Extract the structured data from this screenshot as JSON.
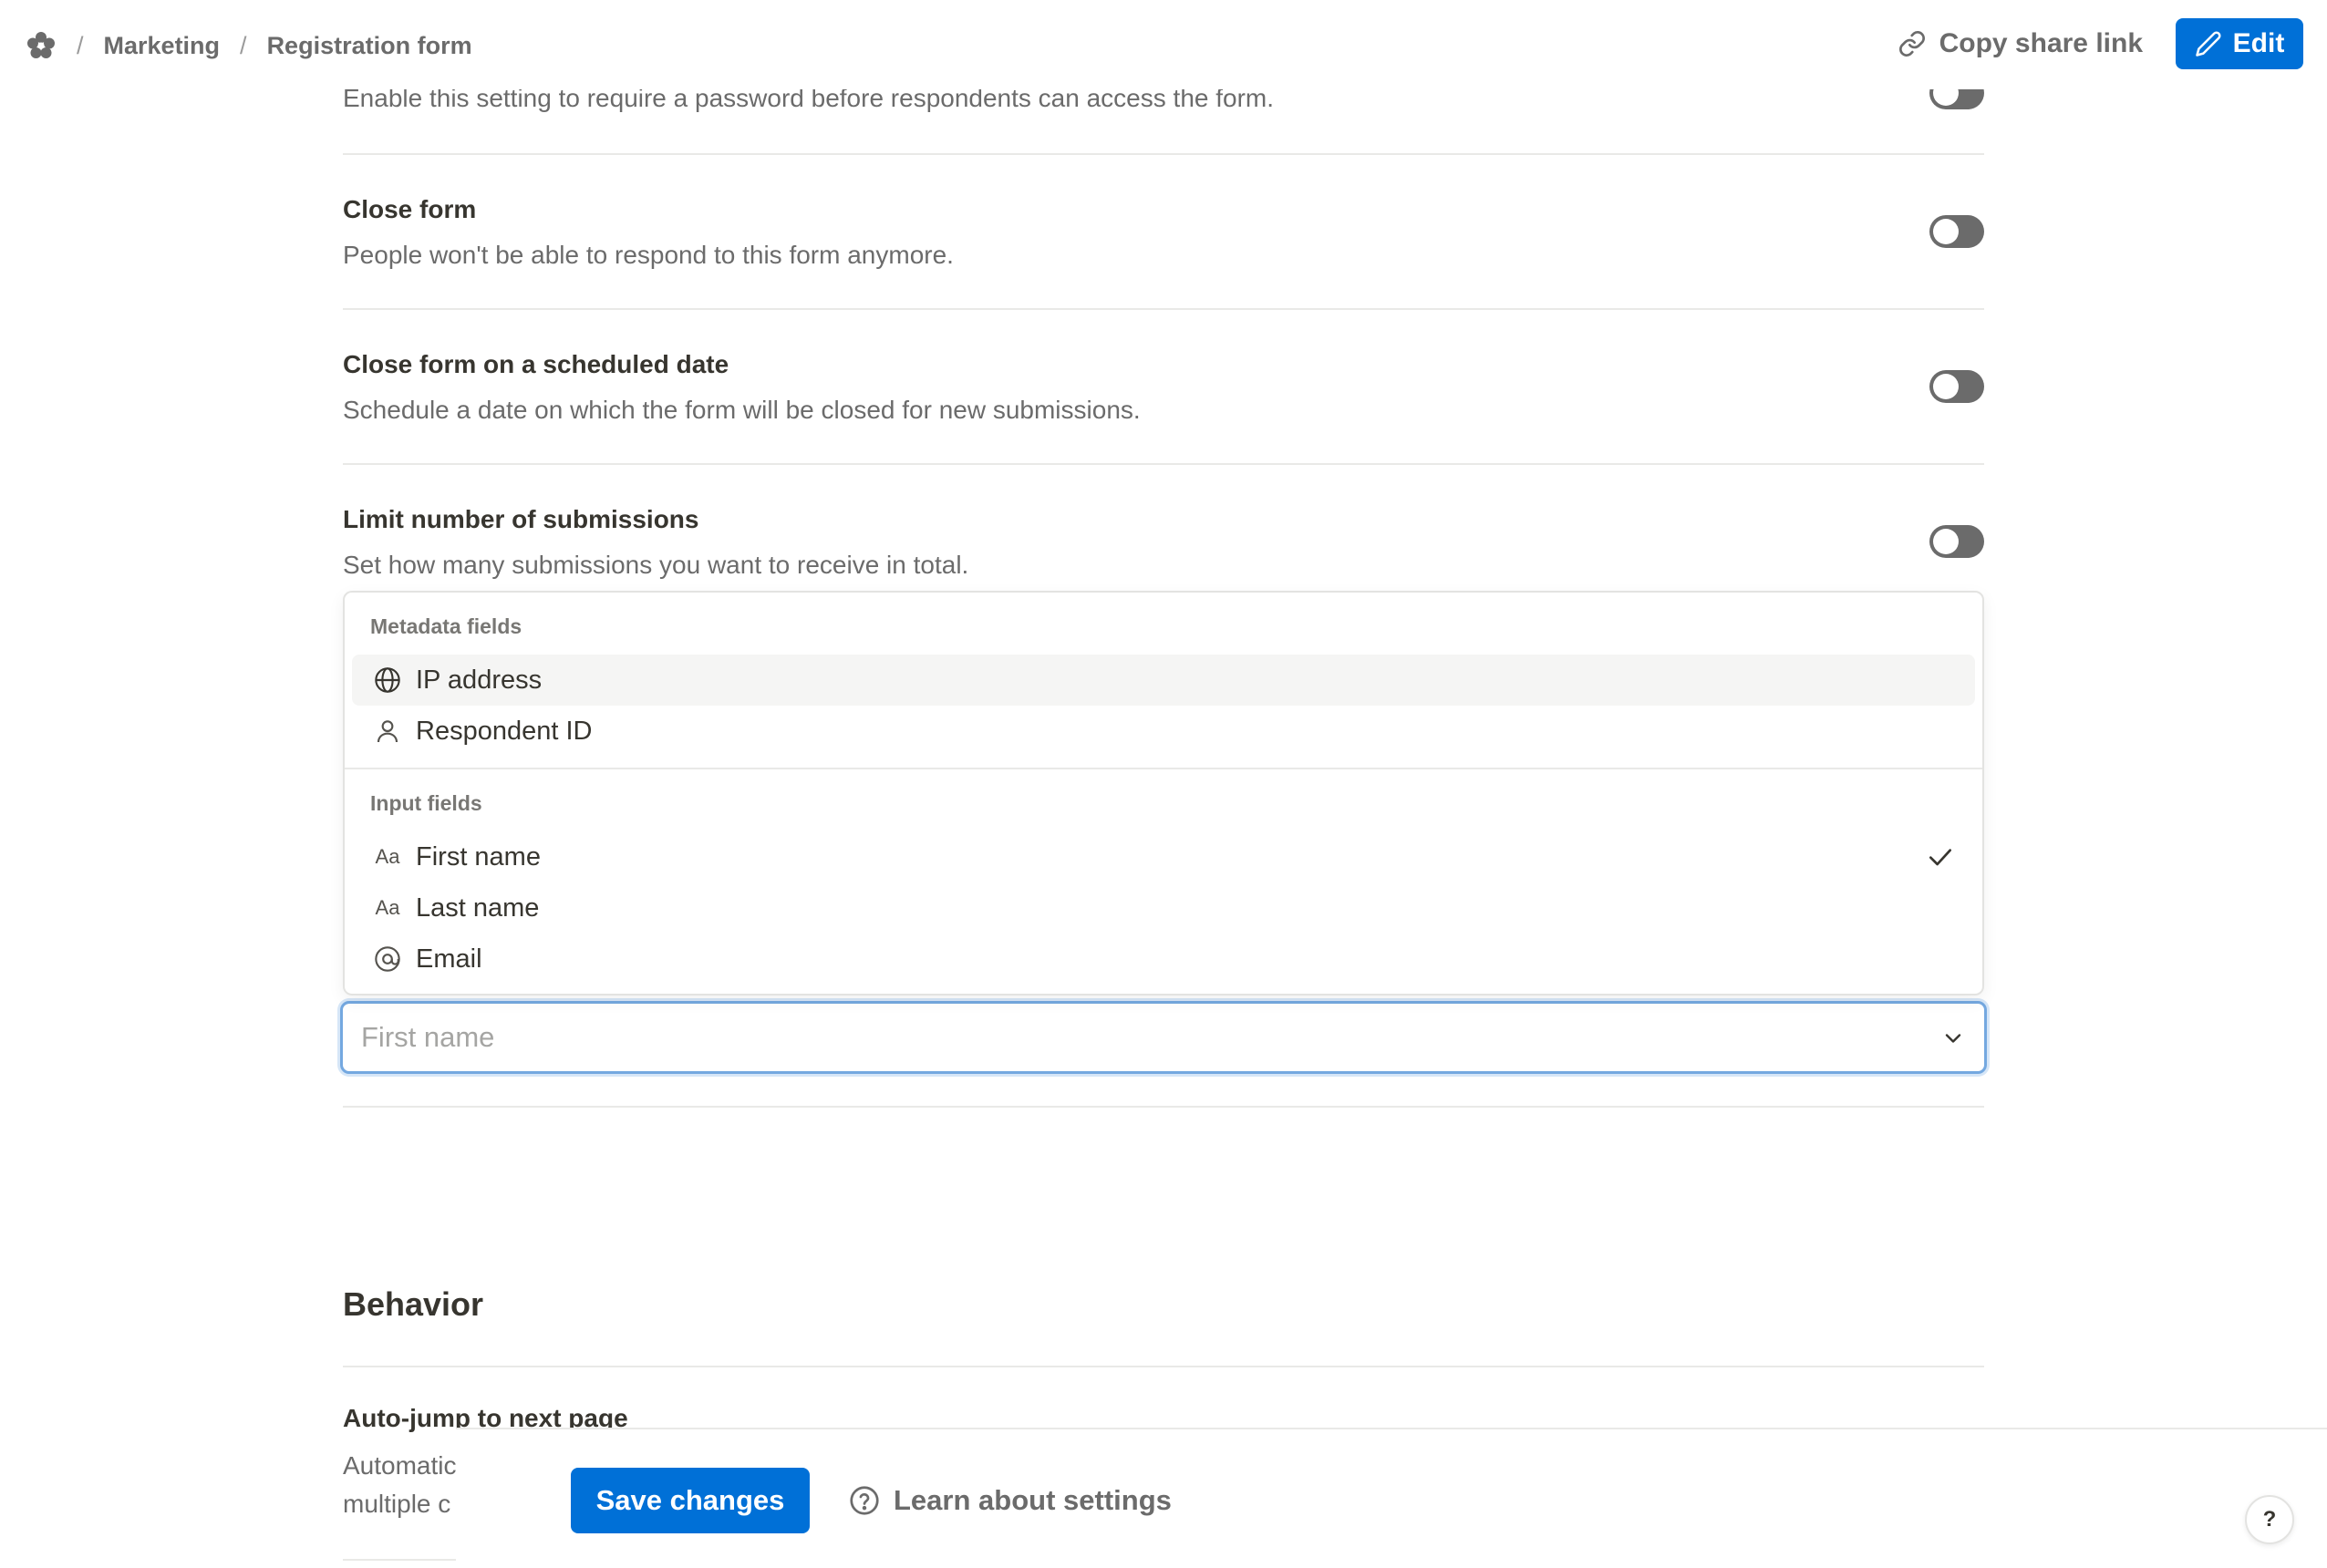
{
  "breadcrumbs": {
    "logo_icon": "flower-logo-icon",
    "items": [
      "Marketing",
      "Registration form"
    ],
    "separator": "/"
  },
  "topbar": {
    "share_label": "Copy share link",
    "edit_label": "Edit"
  },
  "settings": [
    {
      "title": "",
      "desc": "Enable this setting to require a password before respondents can access the form.",
      "enabled": false
    },
    {
      "title": "Close form",
      "desc": "People won't be able to respond to this form anymore.",
      "enabled": false
    },
    {
      "title": "Close form on a scheduled date",
      "desc": "Schedule a date on which the form will be closed for new submissions.",
      "enabled": false
    },
    {
      "title": "Limit number of submissions",
      "desc": "Set how many submissions you want to receive in total.",
      "enabled": false
    }
  ],
  "dropdown": {
    "metadata_label": "Metadata fields",
    "metadata_options": [
      {
        "label": "IP address",
        "icon": "globe-icon"
      },
      {
        "label": "Respondent ID",
        "icon": "person-icon"
      }
    ],
    "input_label": "Input fields",
    "input_options": [
      {
        "label": "First name",
        "icon": "text-field-icon",
        "selected": true
      },
      {
        "label": "Last name",
        "icon": "text-field-icon",
        "selected": false
      },
      {
        "label": "Email",
        "icon": "at-sign-icon",
        "selected": false
      }
    ],
    "text_icon_glyph": "Aa"
  },
  "select": {
    "placeholder": "First name"
  },
  "behavior": {
    "section_title": "Behavior",
    "first_title": "Auto-jump to next page",
    "first_desc_line1": "Automatic",
    "first_desc_line2": "multiple c"
  },
  "bottombar": {
    "save_label": "Save changes",
    "learn_label": "Learn about settings",
    "help_label": "?"
  },
  "colors": {
    "accent": "#0070d7",
    "toggle_off": "#6b6b6b",
    "focus_ring": "#74a8e0"
  }
}
